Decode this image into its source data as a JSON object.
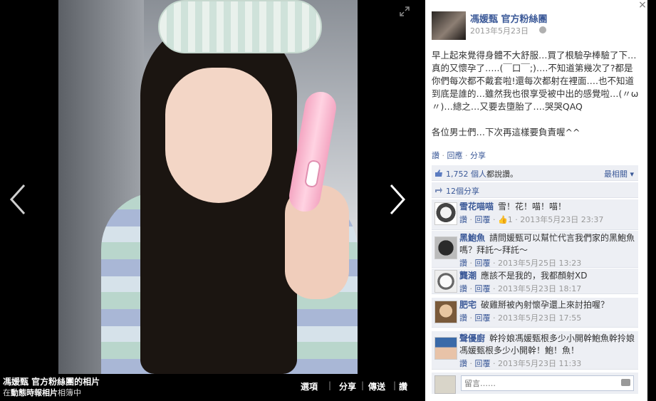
{
  "photo": {
    "album_owner": "馮媛甄 官方粉絲團的相片",
    "album_source_prefix": "在",
    "album_source_link": "動態時報相片",
    "album_source_suffix": "相簿中",
    "actions": [
      "選項",
      "分享",
      "傳送",
      "讚"
    ]
  },
  "post": {
    "page_name": "馮媛甄 官方粉絲團",
    "date": "2013年5月23日",
    "text_paragraph1": "早上起來覺得身體不大舒服…買了根驗孕棒驗了下…真的又懷孕了…..(￣口￣;)….不知道第幾次了?都是你們每次都不戴套啦!還每次都射在裡面….也不知道到底是誰的…雖然我也很享受被中出的感覺啦…(〃ω〃)…總之…又要去墮胎了….哭哭QAQ",
    "text_paragraph2": "各位男士們…下次再這樣要負責喔^^",
    "action_like": "讚",
    "action_comment": "回應",
    "action_share": "分享"
  },
  "likes": {
    "count": "1,752 個人",
    "text": "都說讚。",
    "sort_label": "最相關"
  },
  "shares": {
    "text": "12個分享"
  },
  "comments": [
    {
      "name": "雪花喵喵",
      "text": "雪！花！喵！喵！",
      "like_label": "讚",
      "reply_label": "回覆",
      "likes": "1",
      "date": "2013年5月23日 23:37"
    },
    {
      "name": "黑鮑魚",
      "text": "請問媛甄可以幫忙代言我們家的黑鮑魚嗎？拜託～拜託～",
      "like_label": "讚",
      "reply_label": "回覆",
      "likes": "",
      "date": "2013年5月25日 13:23"
    },
    {
      "name": "龔潮",
      "text": "應該不是我的，我都顏射XD",
      "like_label": "讚",
      "reply_label": "回覆",
      "likes": "",
      "date": "2013年5月23日 18:17"
    },
    {
      "name": "肥宅",
      "text": "破雞掰被內射懷孕還上來討拍喔？",
      "like_label": "讚",
      "reply_label": "回覆",
      "likes": "",
      "date": "2013年5月23日 17:55"
    },
    {
      "name": "聲優廚",
      "text": "幹拎娘馮媛甄根多少小開幹鮑魚幹拎娘馮媛甄根多少小開幹！鮑！魚！",
      "like_label": "讚",
      "reply_label": "回覆",
      "likes": "",
      "date": "2013年5月23日 11:33"
    }
  ],
  "reply": {
    "placeholder": "留言……"
  },
  "colors": {
    "link": "#3b5998",
    "panel_bg": "#ffffff",
    "info_bg": "#edeff4"
  }
}
